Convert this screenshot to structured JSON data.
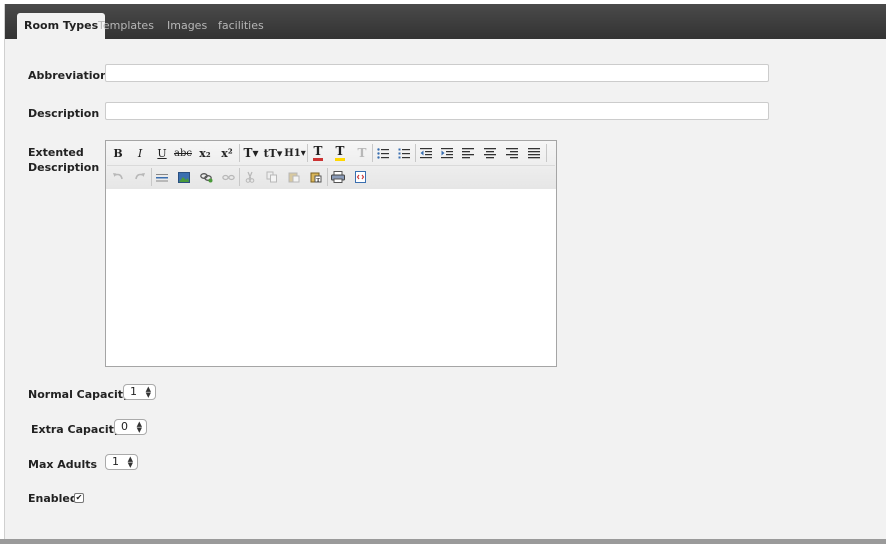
{
  "tabs": [
    {
      "label": "Room Types",
      "active": true
    },
    {
      "label": "Templates",
      "active": false
    },
    {
      "label": "Images",
      "active": false
    },
    {
      "label": "facilities",
      "active": false
    }
  ],
  "form": {
    "abbreviation_label": "Abbreviation",
    "abbreviation_value": "",
    "description_label": "Description",
    "description_value": "",
    "extended_label_line1": "Extented",
    "extended_label_line2": "Description",
    "normal_capacity_label": "Normal Capacity",
    "normal_capacity_value": "1",
    "extra_capacity_label": "Extra Capacity",
    "extra_capacity_value": "0",
    "max_adults_label": "Max Adults",
    "max_adults_value": "1",
    "enabled_label": "Enabled",
    "enabled_checked": true
  },
  "editor": {
    "toolbar": {
      "bold": "B",
      "italic": "I",
      "underline": "U",
      "strike": "abc",
      "subscript": "x₂",
      "superscript": "x²",
      "font_family": "T▾",
      "font_size": "tT▾",
      "heading": "H1▾",
      "text_color": "T",
      "highlight": "T",
      "remove_format": "T"
    },
    "colors": {
      "text_color_bar": "#cc3333",
      "highlight_bar": "#ffd700",
      "icon_blue": "#3a6fb0",
      "icon_green": "#4a9a3a",
      "disabled": "#b8b8b8"
    }
  }
}
